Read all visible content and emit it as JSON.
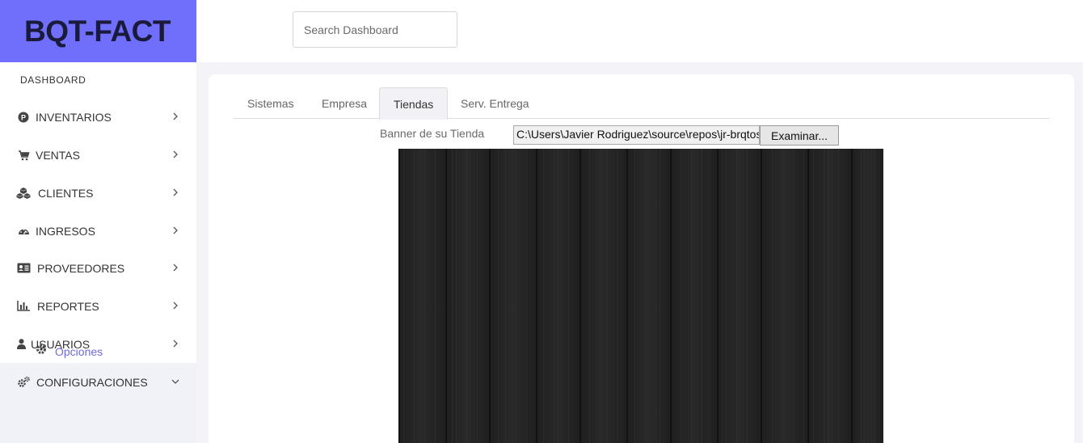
{
  "brand": {
    "title": "BQT-FACT",
    "color": "#6f6ffc"
  },
  "search": {
    "placeholder": "Search Dashboard"
  },
  "sidebar": {
    "section_label": "DASHBOARD",
    "items": [
      {
        "label": "INVENTARIOS",
        "icon": "p-circle-icon"
      },
      {
        "label": "VENTAS",
        "icon": "cart-icon"
      },
      {
        "label": "CLIENTES",
        "icon": "boxes-icon"
      },
      {
        "label": "INGRESOS",
        "icon": "gauge-icon"
      },
      {
        "label": "PROVEEDORES",
        "icon": "id-card-icon"
      },
      {
        "label": "REPORTES",
        "icon": "bar-chart-icon"
      },
      {
        "label": "USUARIOS",
        "icon": "user-icon"
      },
      {
        "label": "CONFIGURACIONES",
        "icon": "gears-icon",
        "expanded": true
      }
    ],
    "sub_items": [
      {
        "label": "Opciones",
        "icon": "gear-icon"
      }
    ]
  },
  "tabs": [
    {
      "label": "Sistemas"
    },
    {
      "label": "Empresa"
    },
    {
      "label": "Tiendas",
      "active": true
    },
    {
      "label": "Serv. Entrega"
    }
  ],
  "banner_field": {
    "label": "Banner de su Tienda",
    "file_value": "C:\\Users\\Javier Rodriguez\\source\\repos\\jr-brqtos",
    "button_label": "Examinar..."
  },
  "colors": {
    "accent": "#6f6ffc",
    "link": "#6c6cd8",
    "banner": "#232323"
  }
}
